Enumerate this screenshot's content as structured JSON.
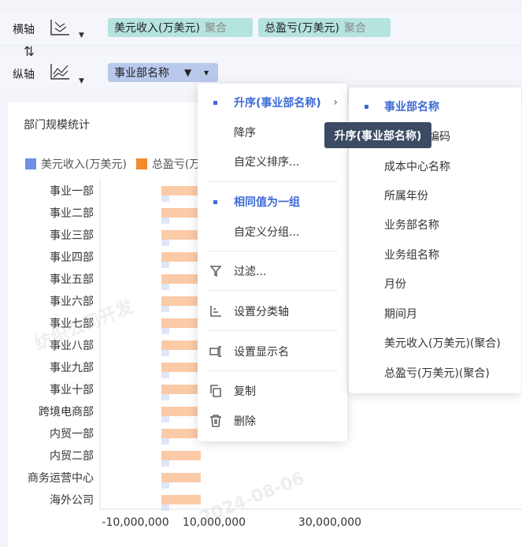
{
  "x_axis": {
    "label": "横轴",
    "fields": [
      {
        "name": "美元收入(万美元)",
        "agg": "聚合"
      },
      {
        "name": "总盈亏(万美元)",
        "agg": "聚合"
      }
    ]
  },
  "y_axis": {
    "label": "纵轴",
    "field": "事业部名称"
  },
  "chart": {
    "title": "部门规模统计",
    "legend": [
      {
        "name": "美元收入(万美元)",
        "color": "#6e8fe3"
      },
      {
        "name": "总盈亏(万...",
        "color": "#f28b2d"
      }
    ]
  },
  "chart_data": {
    "type": "bar",
    "orientation": "horizontal",
    "categories": [
      "事业一部",
      "事业二部",
      "事业三部",
      "事业四部",
      "事业五部",
      "事业六部",
      "事业七部",
      "事业八部",
      "事业九部",
      "事业十部",
      "跨境电商部",
      "内贸一部",
      "内贸二部",
      "商务运营中心",
      "海外公司"
    ],
    "x_ticks": [
      "-10,000,000",
      "10,000,000",
      "30,000,000"
    ]
  },
  "main_menu": {
    "items": [
      {
        "id": "asc",
        "label": "升序(事业部名称)",
        "selected": true,
        "has_sub": true
      },
      {
        "id": "desc",
        "label": "降序"
      },
      {
        "id": "custom-sort",
        "label": "自定义排序..."
      },
      {
        "id": "group-same",
        "label": "相同值为一组",
        "selected": true
      },
      {
        "id": "custom-group",
        "label": "自定义分组..."
      },
      {
        "id": "filter",
        "label": "过滤..."
      },
      {
        "id": "category-axis",
        "label": "设置分类轴"
      },
      {
        "id": "display-name",
        "label": "设置显示名"
      },
      {
        "id": "copy",
        "label": "复制"
      },
      {
        "id": "delete",
        "label": "删除"
      }
    ]
  },
  "sub_menu": {
    "items": [
      {
        "label": "事业部名称",
        "selected": true
      },
      {
        "label": "编码"
      },
      {
        "label": "成本中心名称"
      },
      {
        "label": "所属年份"
      },
      {
        "label": "业务部名称"
      },
      {
        "label": "业务组名称"
      },
      {
        "label": "月份"
      },
      {
        "label": "期间月"
      },
      {
        "label": "美元收入(万美元)(聚合)"
      },
      {
        "label": "总盈亏(万美元)(聚合)"
      }
    ]
  },
  "tooltip": "升序(事业部名称)",
  "watermark": "2024-08-06"
}
